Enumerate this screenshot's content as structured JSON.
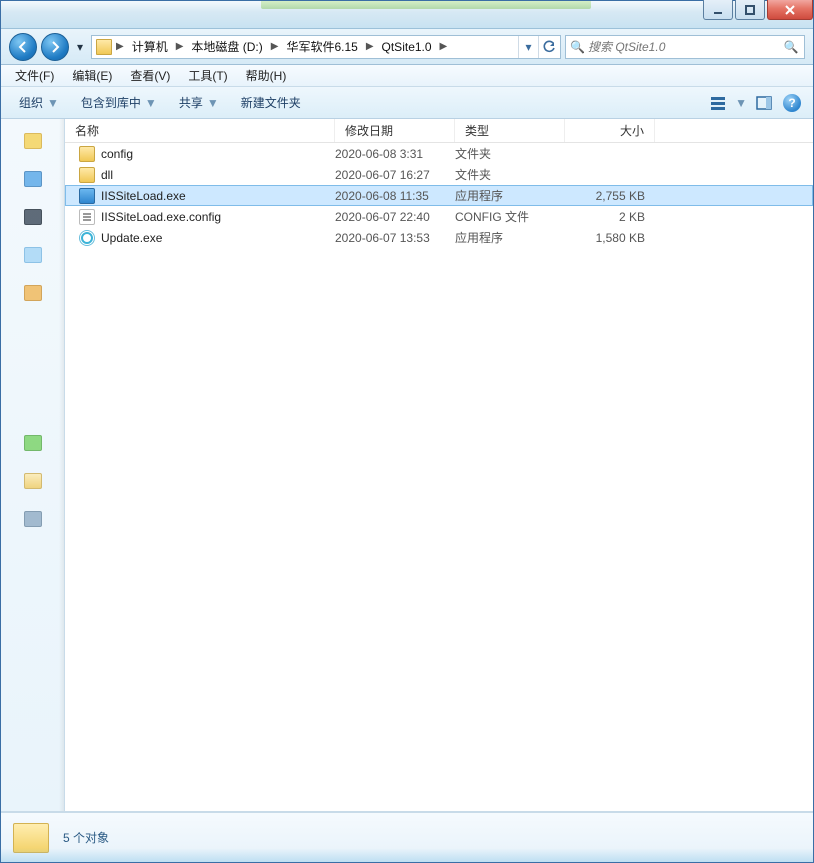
{
  "titlebar": {
    "min_tip": "最小化",
    "max_tip": "最大化",
    "close_tip": "关闭"
  },
  "breadcrumbs": {
    "root_icon": "folder",
    "items": [
      "计算机",
      "本地磁盘 (D:)",
      "华军软件6.15",
      "QtSite1.0"
    ]
  },
  "search": {
    "placeholder": "搜索 QtSite1.0"
  },
  "menubar": {
    "items": [
      "文件(F)",
      "编辑(E)",
      "查看(V)",
      "工具(T)",
      "帮助(H)"
    ]
  },
  "toolbar": {
    "organize": "组织",
    "include": "包含到库中",
    "share": "共享",
    "newfolder": "新建文件夹"
  },
  "columns": {
    "name": "名称",
    "date": "修改日期",
    "type": "类型",
    "size": "大小"
  },
  "files": [
    {
      "icon": "folder",
      "name": "config",
      "date": "2020-06-08 3:31",
      "type": "文件夹",
      "size": "",
      "selected": false
    },
    {
      "icon": "folder",
      "name": "dll",
      "date": "2020-06-07 16:27",
      "type": "文件夹",
      "size": "",
      "selected": false
    },
    {
      "icon": "exe-blue",
      "name": "IISSiteLoad.exe",
      "date": "2020-06-08 11:35",
      "type": "应用程序",
      "size": "2,755 KB",
      "selected": true
    },
    {
      "icon": "config",
      "name": "IISSiteLoad.exe.config",
      "date": "2020-06-07 22:40",
      "type": "CONFIG 文件",
      "size": "2 KB",
      "selected": false
    },
    {
      "icon": "exe-cyan",
      "name": "Update.exe",
      "date": "2020-06-07 13:53",
      "type": "应用程序",
      "size": "1,580 KB",
      "selected": false
    }
  ],
  "status": {
    "text": "5 个对象"
  }
}
